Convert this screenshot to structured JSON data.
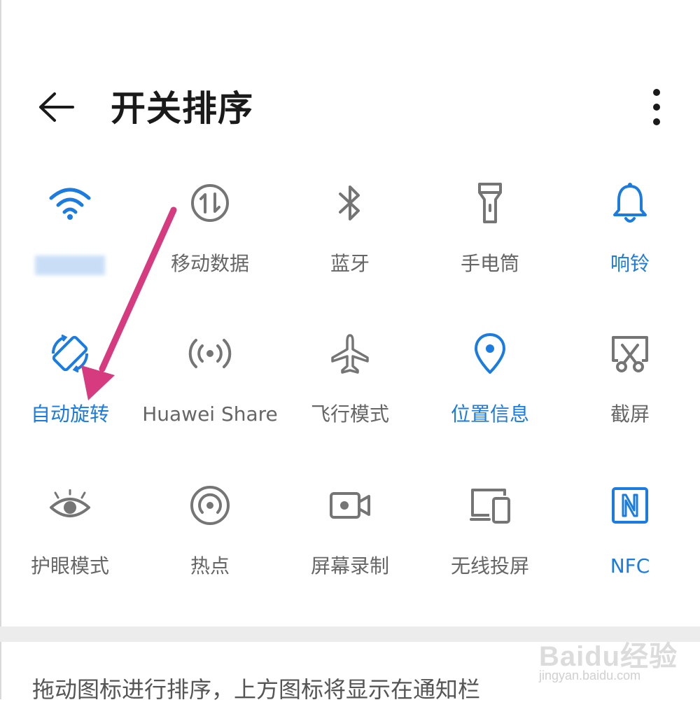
{
  "header": {
    "title": "开关排序",
    "back_icon": "arrow-left-icon",
    "more_icon": "more-vertical-icon"
  },
  "colors": {
    "active": "#1a7be0",
    "inactive": "#757575",
    "label_inactive": "#666666",
    "annotation_arrow": "#d63a7f"
  },
  "toggles": [
    {
      "label": "",
      "icon": "wifi-icon",
      "active": true
    },
    {
      "label": "移动数据",
      "icon": "mobile-data-icon",
      "active": false
    },
    {
      "label": "蓝牙",
      "icon": "bluetooth-icon",
      "active": false
    },
    {
      "label": "手电筒",
      "icon": "flashlight-icon",
      "active": false
    },
    {
      "label": "响铃",
      "icon": "bell-icon",
      "active": true
    },
    {
      "label": "自动旋转",
      "icon": "auto-rotate-icon",
      "active": true
    },
    {
      "label": "Huawei Share",
      "icon": "huawei-share-icon",
      "active": false
    },
    {
      "label": "飞行模式",
      "icon": "airplane-icon",
      "active": false
    },
    {
      "label": "位置信息",
      "icon": "location-pin-icon",
      "active": true
    },
    {
      "label": "截屏",
      "icon": "screenshot-icon",
      "active": false
    },
    {
      "label": "护眼模式",
      "icon": "eye-icon",
      "active": false
    },
    {
      "label": "热点",
      "icon": "hotspot-icon",
      "active": false
    },
    {
      "label": "屏幕录制",
      "icon": "screen-record-icon",
      "active": false
    },
    {
      "label": "无线投屏",
      "icon": "wireless-projection-icon",
      "active": false
    },
    {
      "label": "NFC",
      "icon": "nfc-icon",
      "active": true
    }
  ],
  "footer": {
    "hint": "拖动图标进行排序，上方图标将显示在通知栏"
  },
  "watermark": {
    "logo_text": "Baidu经验",
    "sub_text": "jingyan.baidu.com"
  }
}
